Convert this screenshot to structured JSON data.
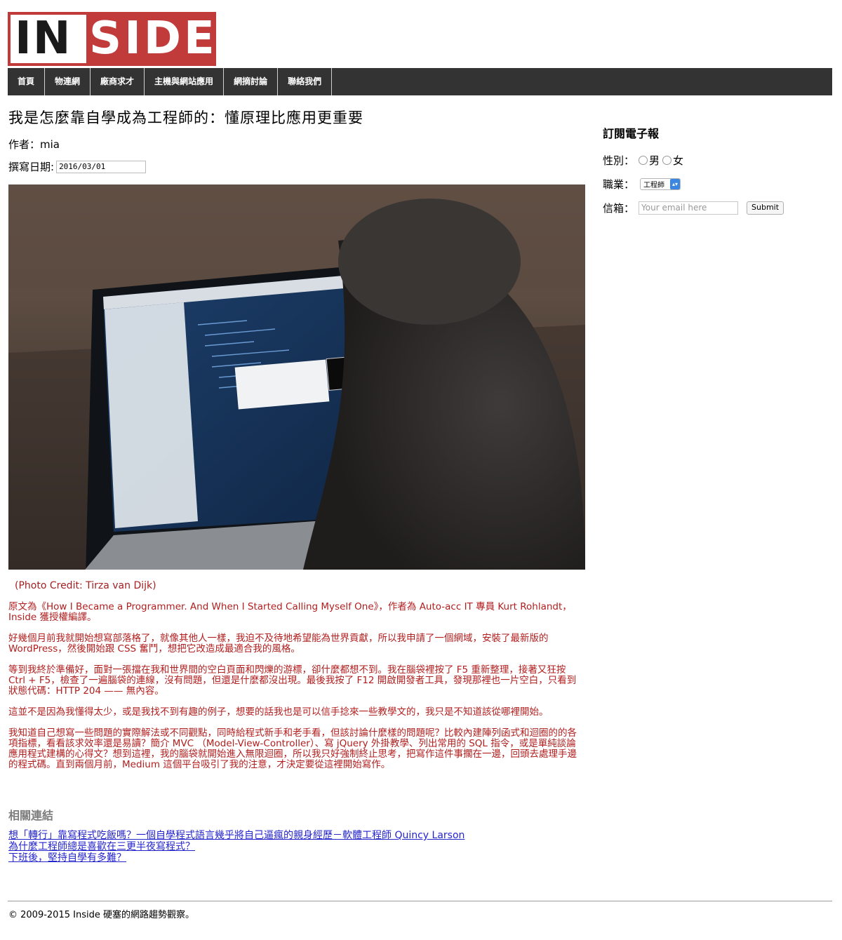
{
  "site": {
    "logo_text_dark": "IN",
    "logo_text_light": "SIDE",
    "brand_color": "#c13b3b"
  },
  "nav": {
    "items": [
      "首頁",
      "物連網",
      "廠商求才",
      "主機與網站應用",
      "網摘討論",
      "聯絡我們"
    ]
  },
  "article": {
    "title": "我是怎麼靠自學成為工程師的：懂原理比應用更重要",
    "author_line": "作者：mia",
    "date_label": "撰寫日期:",
    "date_value": "2016/03/01",
    "photo_credit": "(Photo Credit: Tirza van Dijk)",
    "paragraphs": [
      "原文為《How I Became a Programmer. And When I Started Calling Myself One》，作者為 Auto-acc IT 專員 Kurt Rohlandt，Inside 獲授權編譯。",
      "好幾個月前我就開始想寫部落格了，就像其他人一樣，我迫不及待地希望能為世界貢獻，所以我申請了一個網域，安裝了最新版的 WordPress，然後開始跟 CSS 奮鬥，想把它改造成最適合我的風格。",
      "等到我終於準備好，面對一張擋在我和世界間的空白頁面和閃爍的游標，卻什麼都想不到。我在腦袋裡按了 F5 重新整理，接著又狂按 Ctrl + F5，檢查了一遍腦袋的連線，沒有問題，但還是什麼都沒出現。最後我按了 F12 開啟開發者工具，發現那裡也一片空白，只看到狀態代碼：HTTP 204 —— 無內容。",
      "這並不是因為我懂得太少，或是我找不到有趣的例子，想要的話我也是可以信手捻來一些教學文的，我只是不知道該從哪裡開始。",
      "我知道自己想寫一些問題的實際解法或不同觀點，同時給程式新手和老手看，但該討論什麼樣的問題呢？比較內建陣列函式和迴圈的的各項指標，看看該求效率還是易讀？簡介 MVC （Model-View-Controller）、寫 jQuery 外掛教學、列出常用的 SQL 指令，或是單純談論應用程式建構的心得文？想到這裡，我的腦袋就開始進入無限迴圈，所以我只好強制終止思考，把寫作這件事擱在一邊，回頭去處理手邊的程式碼。直到兩個月前，Medium 這個平台吸引了我的注意，才決定要從這裡開始寫作。"
    ],
    "related_heading": "相關連結",
    "related_links": [
      "想「轉行」靠寫程式吃飯嗎？一個自學程式語言幾乎將自己逼瘋的親身經歷－軟體工程師 Quincy Larson",
      "為什麼工程師總是喜歡在三更半夜寫程式？",
      "下班後，堅持自學有多難？"
    ]
  },
  "sidebar": {
    "title": "訂閱電子報",
    "gender_label": "性別：",
    "gender_options": [
      "男",
      "女"
    ],
    "job_label": "職業：",
    "job_selected": "工程師",
    "email_label": "信箱：",
    "email_placeholder": "Your email here",
    "submit_label": "Submit"
  },
  "footer": {
    "text": "© 2009-2015 Inside 硬塞的網路趨勢觀察。"
  }
}
